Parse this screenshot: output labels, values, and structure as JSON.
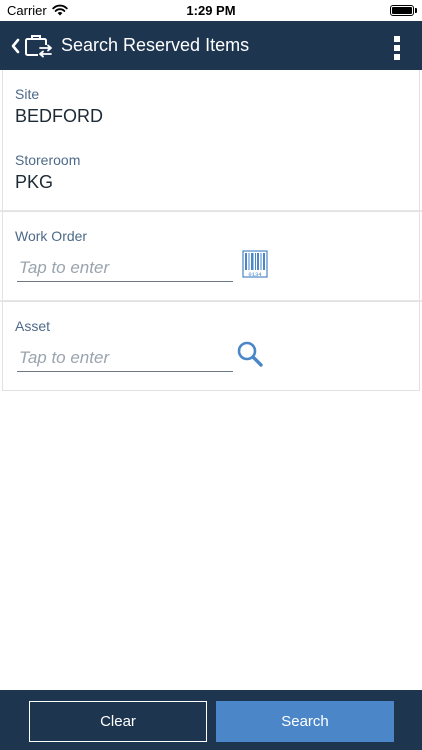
{
  "status_bar": {
    "carrier": "Carrier",
    "time": "1:29 PM"
  },
  "header": {
    "title": "Search Reserved Items",
    "back_icon": "chevron-left-icon",
    "app_icon": "exchange-case-icon",
    "menu_icon": "more-vertical-icon"
  },
  "site": {
    "label": "Site",
    "value": "BEDFORD"
  },
  "storeroom": {
    "label": "Storeroom",
    "value": "PKG"
  },
  "work_order": {
    "label": "Work Order",
    "placeholder": "Tap to enter",
    "icon": "barcode-scan-icon",
    "barcode_digits": "0134"
  },
  "asset": {
    "label": "Asset",
    "placeholder": "Tap to enter",
    "icon": "search-icon"
  },
  "actions": {
    "clear_label": "Clear",
    "search_label": "Search"
  },
  "colors": {
    "header_bg": "#1e3550",
    "accent": "#4a86c8",
    "label": "#4d6a88"
  }
}
